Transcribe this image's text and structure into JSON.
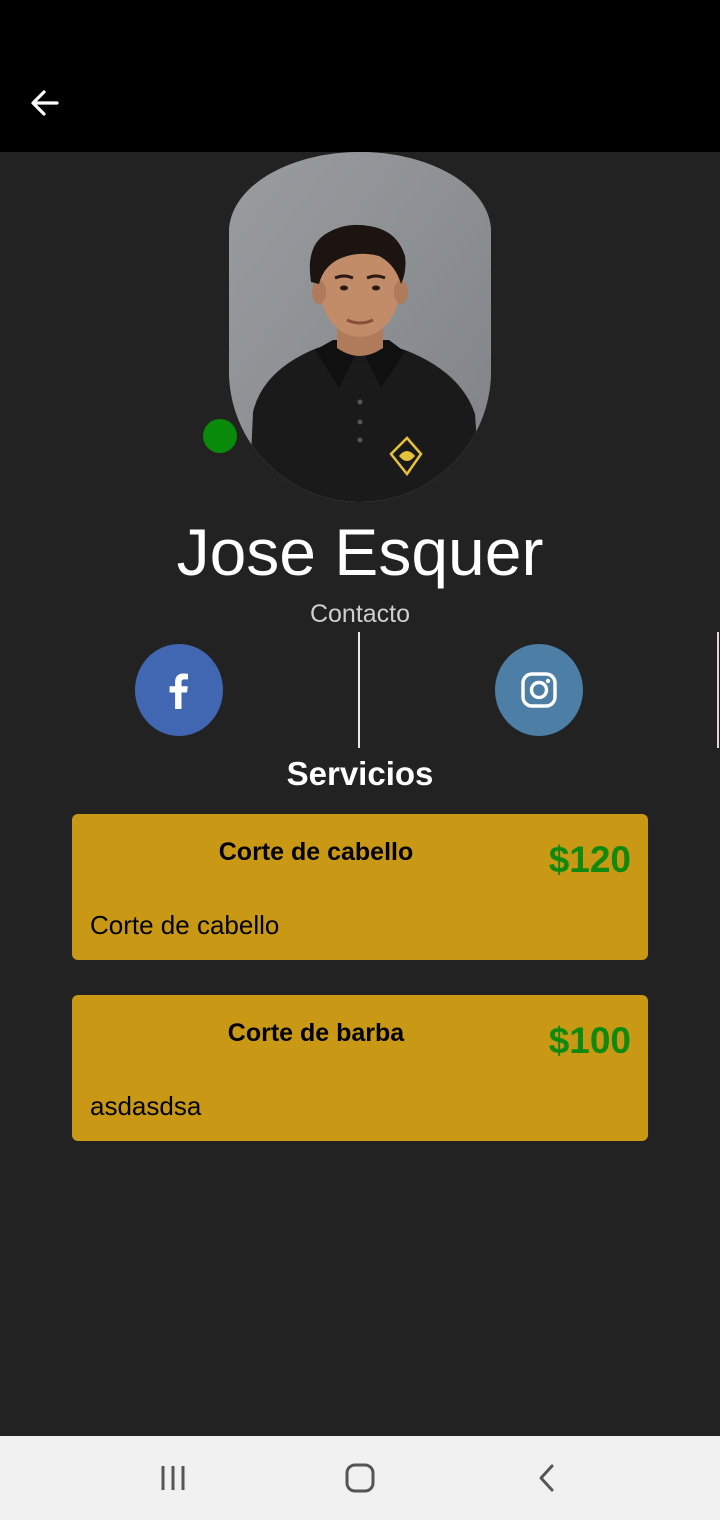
{
  "profile": {
    "name": "Jose Esquer",
    "status_color": "#0a8a0a"
  },
  "contact": {
    "label": "Contacto",
    "facebook_color": "#4267b2",
    "instagram_color": "#4c7ea6"
  },
  "services": {
    "title": "Servicios",
    "card_color": "#c99915",
    "price_color": "#0f8a0f",
    "items": [
      {
        "name": "Corte de cabello",
        "price": "$120",
        "description": "Corte de cabello"
      },
      {
        "name": "Corte de barba",
        "price": "$100",
        "description": "asdasdsa"
      }
    ]
  },
  "icons": {
    "back": "arrow-left-icon",
    "facebook": "facebook-icon",
    "instagram": "instagram-icon",
    "recents": "recents-icon",
    "home": "home-icon",
    "nav_back": "chevron-left-icon"
  }
}
